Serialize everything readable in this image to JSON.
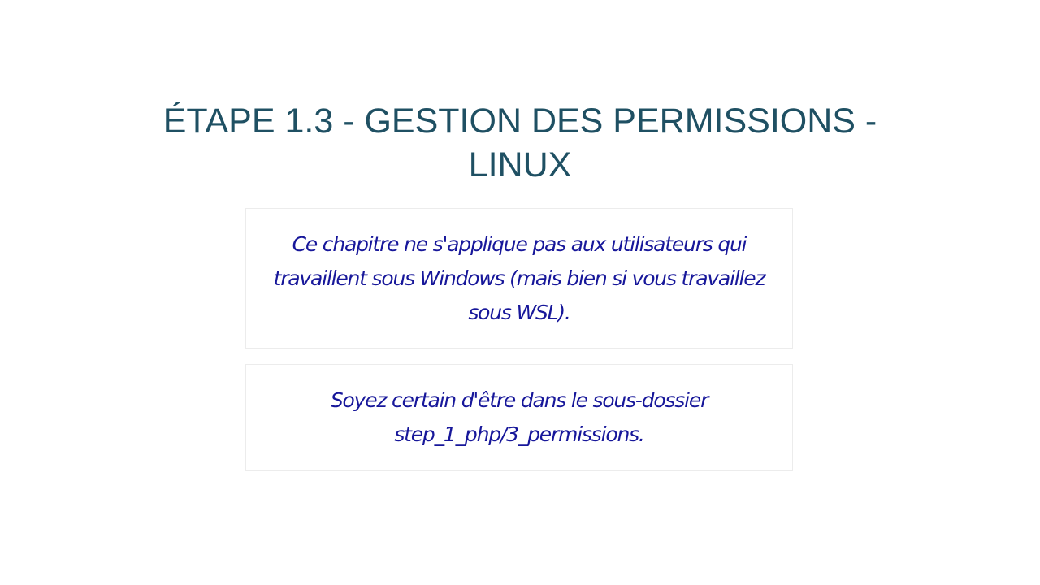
{
  "slide": {
    "title": "ÉTAPE 1.3 - GESTION DES PERMISSIONS - LINUX",
    "notes": [
      "Ce chapitre ne s'applique pas aux utilisateurs qui travaillent sous Windows (mais bien si vous travaillez sous WSL).",
      "Soyez certain d'être dans le sous-dossier step_1_php/3_permissions."
    ]
  },
  "colors": {
    "title": "#1f5063",
    "note_text": "#17179a",
    "box_border": "#ececec",
    "background": "#ffffff"
  }
}
